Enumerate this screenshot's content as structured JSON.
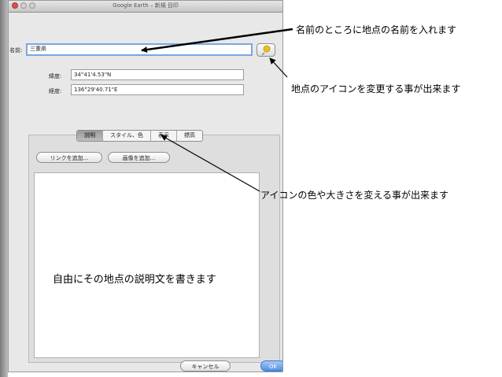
{
  "window": {
    "title": "Google Earth – 新規 目印"
  },
  "form": {
    "name_label": "名前:",
    "name_value": "三重県",
    "lat_label": "緯度:",
    "lat_value": "34°41'4.53\"N",
    "lon_label": "経度:",
    "lon_value": "136°29'40.71\"E"
  },
  "tabs": [
    {
      "label": "説明"
    },
    {
      "label": "スタイル、色"
    },
    {
      "label": "表示"
    },
    {
      "label": "標高"
    }
  ],
  "buttons": {
    "add_link": "リンクを追加...",
    "add_image": "画像を追加...",
    "cancel": "キャンセル",
    "ok": "OK"
  },
  "annotations": {
    "name_note": "名前のところに地点の名前を入れます",
    "icon_note": "地点のアイコンを変更する事が出来ます",
    "style_note": "アイコンの色や大きさを変える事が出来ます",
    "desc_note": "自由にその地点の説明文を書きます"
  },
  "colors": {
    "accent": "#4c8ee6",
    "pin": "#e8c21c"
  }
}
